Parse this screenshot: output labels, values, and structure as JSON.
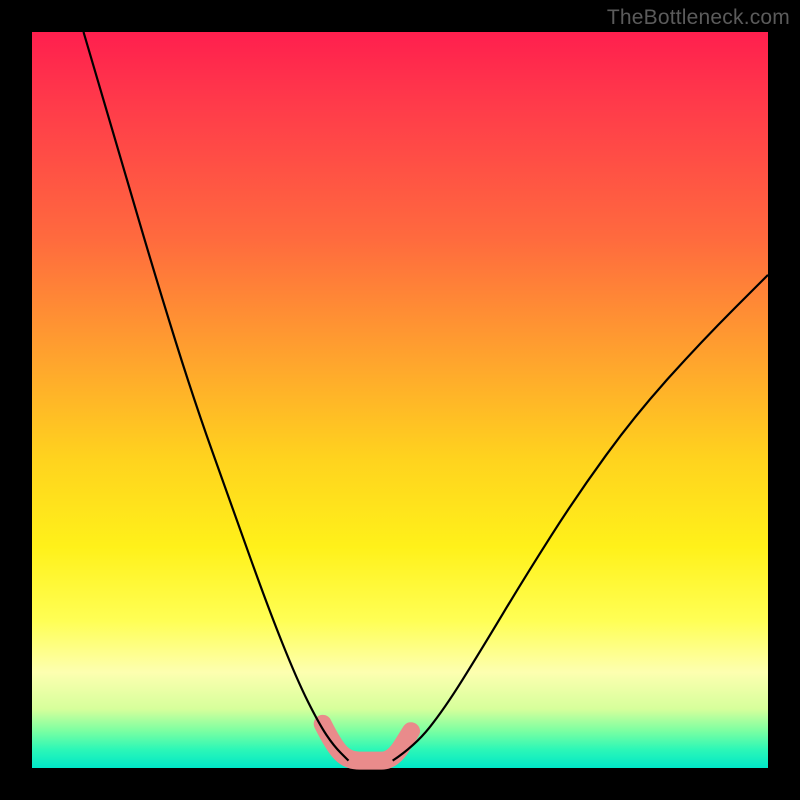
{
  "attribution": "TheBottleneck.com",
  "chart_data": {
    "type": "line",
    "title": "",
    "xlabel": "",
    "ylabel": "",
    "xlim": [
      0,
      100
    ],
    "ylim": [
      0,
      100
    ],
    "grid": false,
    "legend": false,
    "series": [
      {
        "name": "left-curve",
        "x": [
          7,
          12,
          17,
          22,
          27,
          32,
          36,
          39,
          41,
          43
        ],
        "values": [
          100,
          83,
          66,
          50,
          36,
          22,
          12,
          6,
          3,
          1
        ]
      },
      {
        "name": "right-curve",
        "x": [
          49,
          52,
          56,
          61,
          67,
          74,
          82,
          91,
          100
        ],
        "values": [
          1,
          3,
          8,
          16,
          26,
          37,
          48,
          58,
          67
        ]
      },
      {
        "name": "valley-band",
        "x": [
          39.5,
          41,
          43,
          46,
          49,
          51.5
        ],
        "values": [
          6,
          3,
          1,
          1,
          1,
          5
        ]
      }
    ],
    "styles": {
      "left-curve": {
        "stroke": "#000000",
        "width": 2.2
      },
      "right-curve": {
        "stroke": "#000000",
        "width": 2.2
      },
      "valley-band": {
        "stroke": "#e98b8b",
        "width": 18,
        "linecap": "round",
        "linejoin": "round"
      }
    }
  }
}
